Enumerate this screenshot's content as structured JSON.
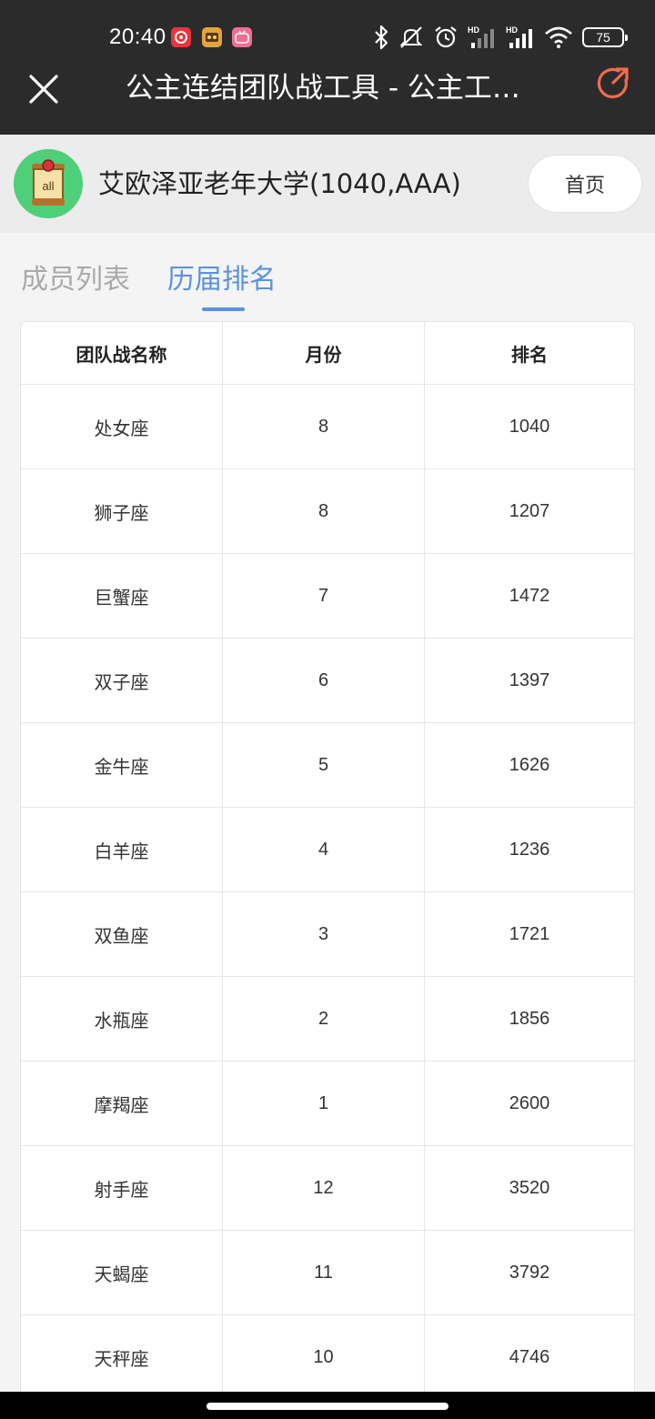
{
  "status_bar": {
    "time": "20:40",
    "battery_level": "75",
    "signal_label_1": "HD",
    "signal_label_2": "HD",
    "icons": [
      "netease-music-icon",
      "game-app-icon",
      "bilibili-icon",
      "bluetooth-icon",
      "mute-icon",
      "alarm-icon",
      "signal-icon",
      "signal-icon",
      "wifi-icon",
      "battery-icon"
    ]
  },
  "titlebar": {
    "title": "公主连结团队战工具 - 公主工…",
    "accent_color": "#f26b4e"
  },
  "team": {
    "name": "艾欧泽亚老年大学(1040,AAA)",
    "avatar_text": "all",
    "home_label": "首页"
  },
  "tabs": [
    {
      "label": "成员列表",
      "active": false
    },
    {
      "label": "历届排名",
      "active": true
    }
  ],
  "tab_active_color": "#5b93dc",
  "table": {
    "columns": [
      "团队战名称",
      "月份",
      "排名"
    ],
    "rows": [
      {
        "name": "处女座",
        "month": "8",
        "rank": "1040"
      },
      {
        "name": "狮子座",
        "month": "8",
        "rank": "1207"
      },
      {
        "name": "巨蟹座",
        "month": "7",
        "rank": "1472"
      },
      {
        "name": "双子座",
        "month": "6",
        "rank": "1397"
      },
      {
        "name": "金牛座",
        "month": "5",
        "rank": "1626"
      },
      {
        "name": "白羊座",
        "month": "4",
        "rank": "1236"
      },
      {
        "name": "双鱼座",
        "month": "3",
        "rank": "1721"
      },
      {
        "name": "水瓶座",
        "month": "2",
        "rank": "1856"
      },
      {
        "name": "摩羯座",
        "month": "1",
        "rank": "2600"
      },
      {
        "name": "射手座",
        "month": "12",
        "rank": "3520"
      },
      {
        "name": "天蝎座",
        "month": "11",
        "rank": "3792"
      },
      {
        "name": "天秤座",
        "month": "10",
        "rank": "4746"
      }
    ]
  }
}
